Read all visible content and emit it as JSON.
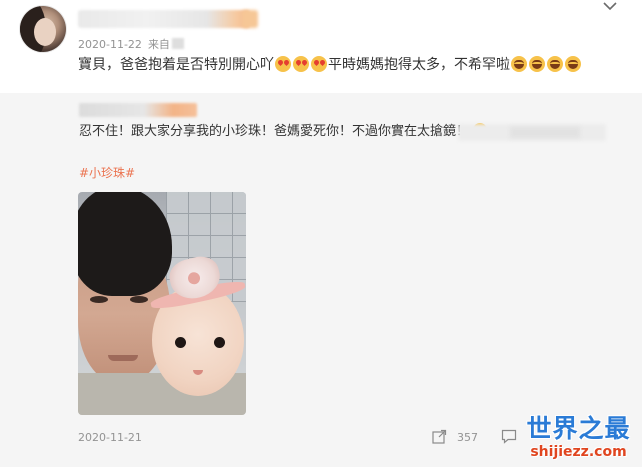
{
  "post": {
    "date": "2020-11-22",
    "source_prefix": "来自",
    "text": "寶貝，爸爸抱着是否特別開心吖",
    "text_after": "平時媽媽抱得太多，不希罕啦",
    "emojis_before": [
      "love-eyes-emoji",
      "love-eyes-emoji",
      "love-eyes-emoji"
    ],
    "emojis_after": [
      "laughing-emoji",
      "laughing-emoji",
      "laughing-emoji",
      "laughing-emoji"
    ]
  },
  "repost": {
    "text": "忍不住！跟大家分享我的小珍珠！爸媽愛死你！不過你實在太搶鏡！",
    "hashtag": "#小珍珠#",
    "date": "2020-11-21",
    "share_count": "357"
  },
  "watermark": {
    "name": "世界之最",
    "url": "shijiezz.com"
  },
  "colors": {
    "hashtag": "#eb7350",
    "muted_text": "#939393",
    "repost_bg": "#f5f5f5",
    "watermark_blue": "#2a7bd6",
    "watermark_red": "#e0451f"
  }
}
